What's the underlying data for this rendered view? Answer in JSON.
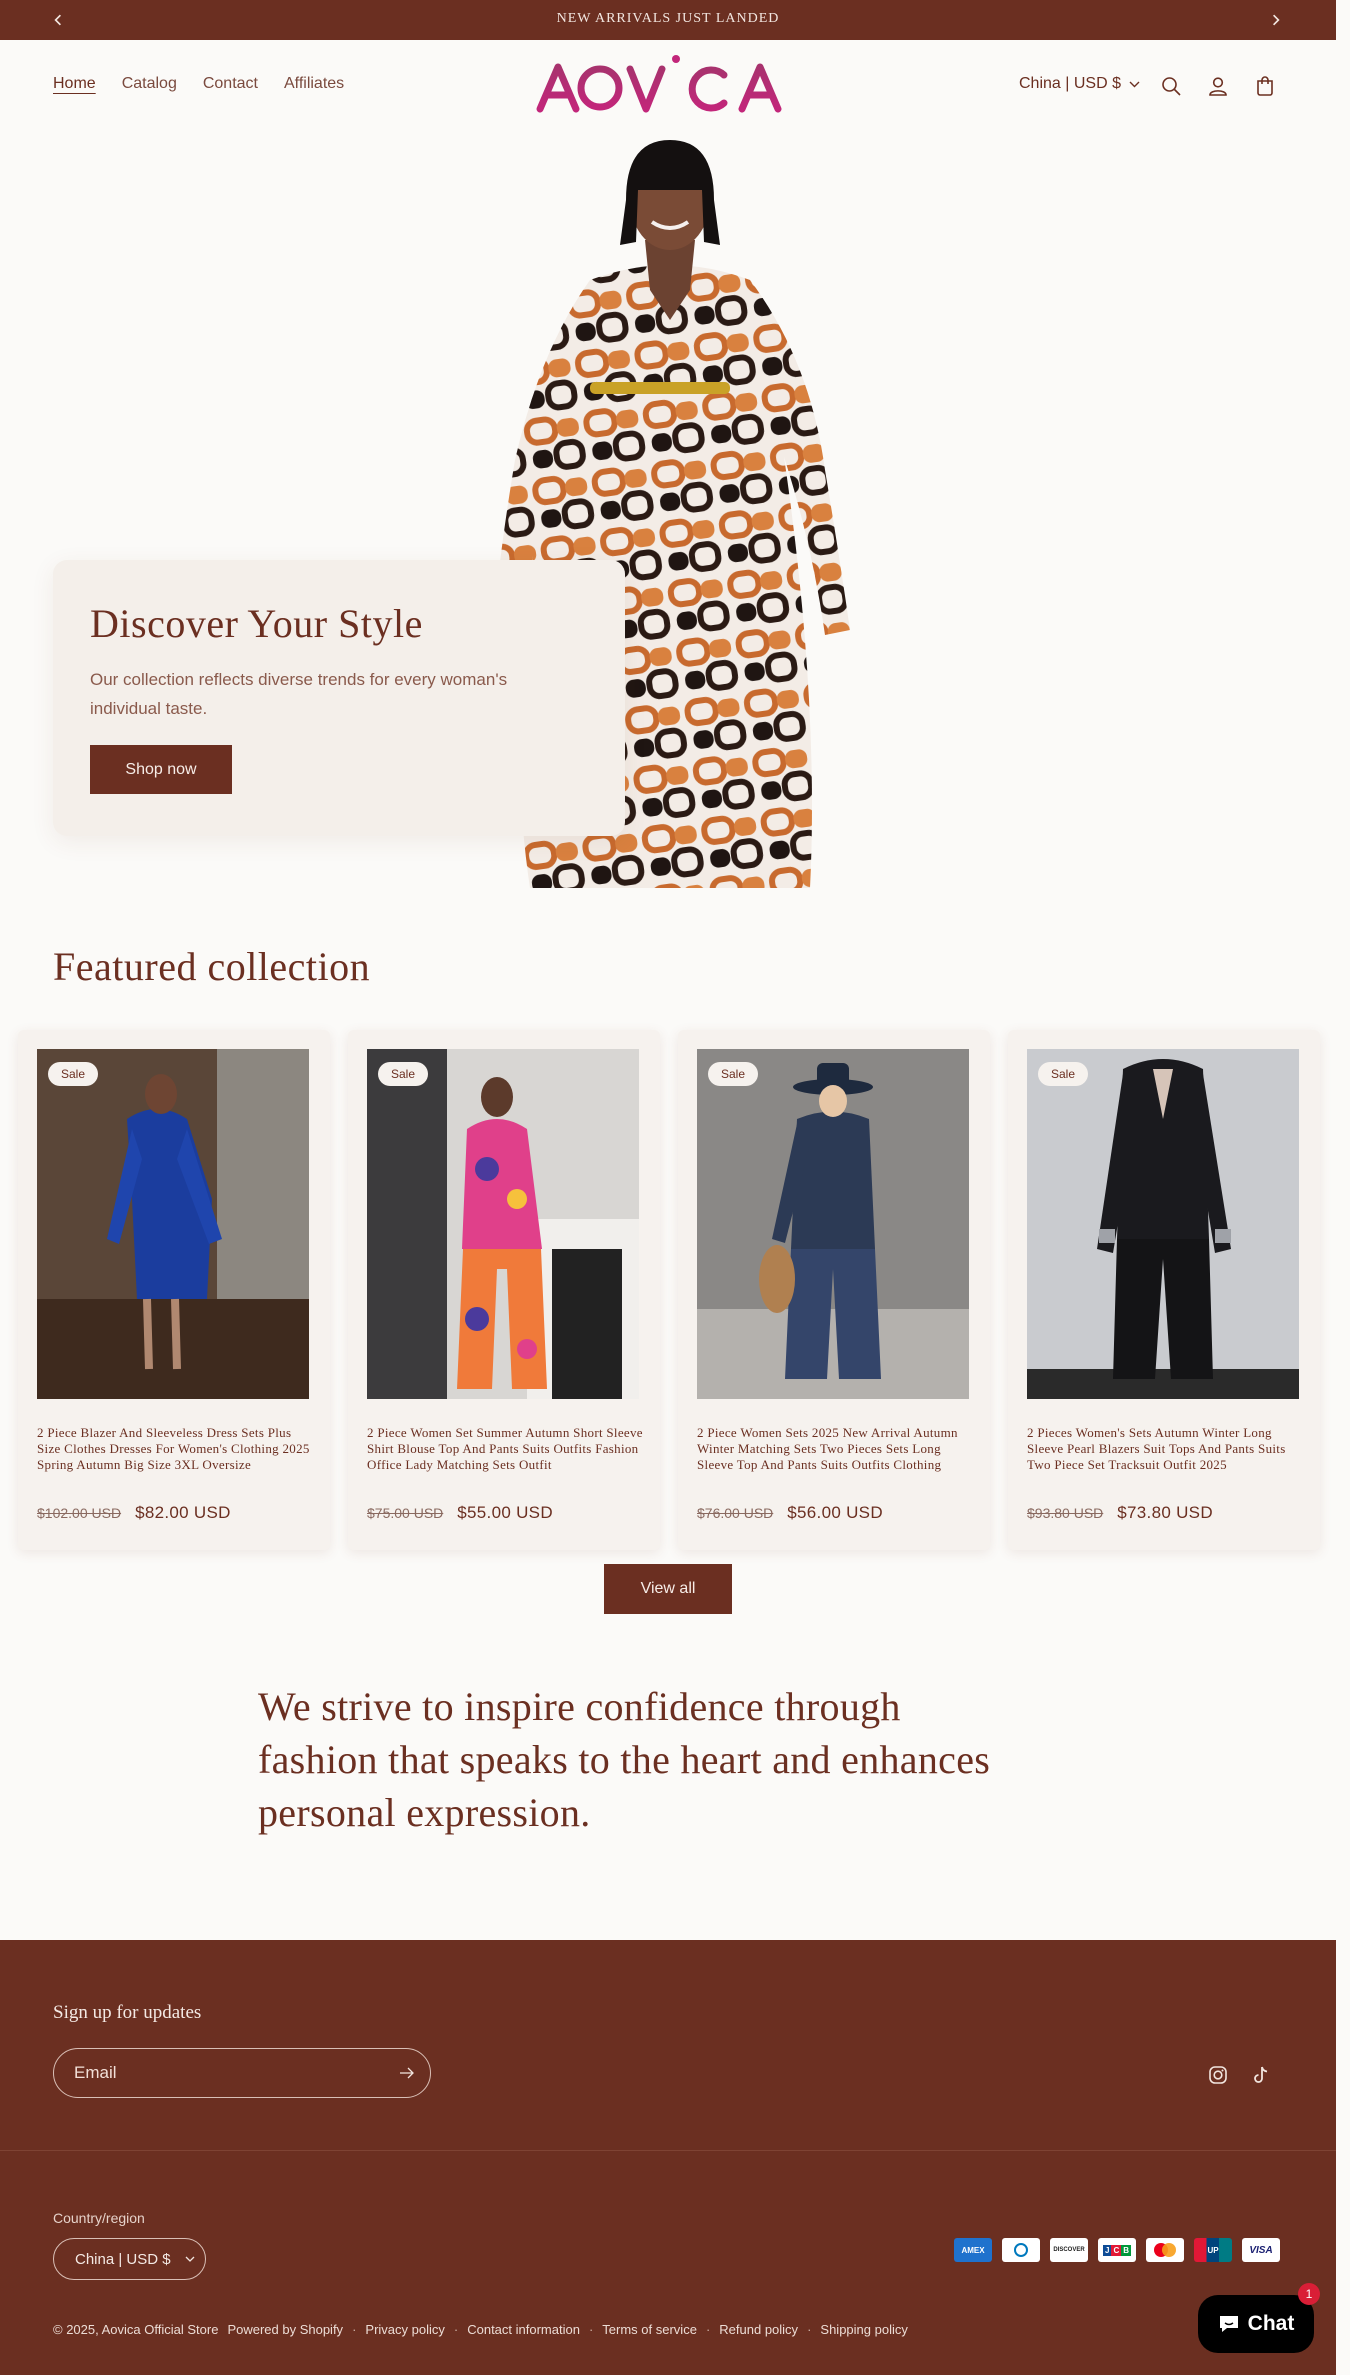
{
  "announcement": {
    "text": "NEW ARRIVALS JUST LANDED"
  },
  "header": {
    "nav": [
      "Home",
      "Catalog",
      "Contact",
      "Affiliates"
    ],
    "logo_text": "AOVICA",
    "country": "China | USD $"
  },
  "hero": {
    "title": "Discover Your Style",
    "text": "Our collection reflects diverse trends for every woman's individual taste.",
    "button": "Shop now"
  },
  "featured": {
    "title": "Featured collection",
    "badge": "Sale",
    "products": [
      {
        "name": "2 Piece Blazer And Sleeveless Dress Sets Plus Size Clothes Dresses For Women's Clothing 2025 Spring Autumn Big Size 3XL Oversize",
        "old_price": "$102.00 USD",
        "price": "$82.00 USD"
      },
      {
        "name": "2 Piece Women Set Summer Autumn Short Sleeve Shirt Blouse Top And Pants Suits Outfits Fashion Office Lady Matching Sets Outfit",
        "old_price": "$75.00 USD",
        "price": "$55.00 USD"
      },
      {
        "name": "2 Piece Women Sets 2025 New Arrival Autumn Winter Matching Sets Two Pieces Sets Long Sleeve Top And Pants Suits Outfits Clothing",
        "old_price": "$76.00 USD",
        "price": "$56.00 USD"
      },
      {
        "name": "2 Pieces Women's Sets Autumn Winter Long Sleeve Pearl Blazers Suit Tops And Pants Suits Two Piece Set Tracksuit Outfit 2025",
        "old_price": "$93.80 USD",
        "price": "$73.80 USD"
      }
    ],
    "view_all": "View all"
  },
  "statement": "We strive to inspire confidence through fashion that speaks to the heart and enhances personal expression.",
  "footer": {
    "signup_title": "Sign up for updates",
    "email_placeholder": "Email",
    "country_label": "Country/region",
    "country": "China | USD $",
    "payments": [
      "American Express",
      "Diners Club",
      "Discover",
      "JCB",
      "Mastercard",
      "UnionPay",
      "Visa"
    ],
    "copyright": "© 2025, Aovica Official Store",
    "powered": "Powered by Shopify",
    "links": [
      "Privacy policy",
      "Contact information",
      "Terms of service",
      "Refund policy",
      "Shipping policy"
    ]
  },
  "chat": {
    "label": "Chat",
    "count": "1"
  },
  "colors": {
    "brand": "#6b2f21",
    "logo": "#b4236f",
    "background": "#fbfaf8"
  }
}
